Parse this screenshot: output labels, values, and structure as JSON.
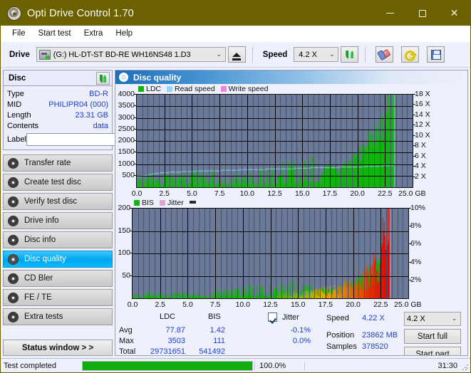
{
  "window": {
    "title": "Opti Drive Control 1.70",
    "icon": "disc-icon",
    "minimize": "–",
    "maximize": "□",
    "close": "✕"
  },
  "menu": {
    "items": [
      "File",
      "Start test",
      "Extra",
      "Help"
    ]
  },
  "toolbar": {
    "drive_label": "Drive",
    "drive_value": "(G:)  HL-DT-ST BD-RE  WH16NS48 1.D3",
    "eject_title": "eject-button",
    "speed_label": "Speed",
    "speed_value": "4.2 X",
    "refresh_title": "refresh-button",
    "erase_title": "erase-button",
    "key_title": "key-button",
    "save_title": "save-button",
    "arrow": "⌄"
  },
  "sidebar": {
    "disc": {
      "title": "Disc",
      "refresh_icon": "refresh-icon",
      "rows": [
        {
          "key": "Type",
          "value": "BD-R"
        },
        {
          "key": "MID",
          "value": "PHILIPR04 (000)"
        },
        {
          "key": "Length",
          "value": "23.31 GB"
        },
        {
          "key": "Contents",
          "value": "data"
        }
      ],
      "label_key": "Label",
      "label_value": "",
      "label_placeholder": "",
      "label_icon": "disc-icon"
    },
    "nav": [
      {
        "label": "Transfer rate",
        "active": false
      },
      {
        "label": "Create test disc",
        "active": false
      },
      {
        "label": "Verify test disc",
        "active": false
      },
      {
        "label": "Drive info",
        "active": false
      },
      {
        "label": "Disc info",
        "active": false
      },
      {
        "label": "Disc quality",
        "active": true
      },
      {
        "label": "CD Bler",
        "active": false
      },
      {
        "label": "FE / TE",
        "active": false
      },
      {
        "label": "Extra tests",
        "active": false
      }
    ],
    "status_window_button": "Status window > >"
  },
  "content": {
    "header_title": "Disc quality",
    "header_icon": "disc-quality-icon"
  },
  "stats": {
    "col_ldc": "LDC",
    "col_bis": "BIS",
    "jitter_label": "Jitter",
    "jitter_checked": true,
    "rows": [
      {
        "key": "Avg",
        "ldc": "77.87",
        "bis": "1.42",
        "jitter": "-0.1%"
      },
      {
        "key": "Max",
        "ldc": "3503",
        "bis": "111",
        "jitter": "0.0%"
      },
      {
        "key": "Total",
        "ldc": "29731651",
        "bis": "541492",
        "jitter": ""
      }
    ],
    "speed_key": "Speed",
    "speed_value": "4.22 X",
    "speed_select": "4.2 X",
    "position_key": "Position",
    "position_value": "23862 MB",
    "samples_key": "Samples",
    "samples_value": "378520",
    "start_full_button": "Start full",
    "start_part_button": "Start part"
  },
  "statusbar": {
    "text": "Test completed",
    "percent_label": "100.0%",
    "percent_value": 100,
    "time": "31:30"
  },
  "colors": {
    "ldc_green": "#11b40c",
    "read_speed_blue": "#8fd8f5",
    "write_speed_pink": "#f57fe0",
    "bis_green": "#11b40c",
    "jitter_pink": "#d9a8d9",
    "plot_bg": "#6b7a99",
    "title_bar": "#6b6100",
    "accent_active": "#00a6ef",
    "progress_green": "#12ac12",
    "value_blue": "#1a3fd0"
  },
  "chart_data": [
    {
      "type": "area",
      "name": "ldc-chart",
      "title": "",
      "xlabel": "GB",
      "ylabel": "",
      "xlim": [
        0,
        25
      ],
      "ylim": [
        0,
        4000
      ],
      "y2lim": [
        0,
        18
      ],
      "y2label": "X",
      "xticks": [
        0.0,
        2.5,
        5.0,
        7.5,
        10.0,
        12.5,
        15.0,
        17.5,
        20.0,
        22.5,
        25.0
      ],
      "xticklabels": [
        "0.0",
        "2.5",
        "5.0",
        "7.5",
        "10.0",
        "12.5",
        "15.0",
        "17.5",
        "20.0",
        "22.5",
        "25.0 GB"
      ],
      "yticks": [
        500,
        1000,
        1500,
        2000,
        2500,
        3000,
        3500,
        4000
      ],
      "yticklabels": [
        "500",
        "1000",
        "1500",
        "2000",
        "2500",
        "3000",
        "3500",
        "4000"
      ],
      "y2ticks": [
        2,
        4,
        6,
        8,
        10,
        12,
        14,
        16,
        18
      ],
      "y2ticklabels": [
        "2 X",
        "4 X",
        "6 X",
        "8 X",
        "10 X",
        "12 X",
        "14 X",
        "16 X",
        "18 X"
      ],
      "grid": true,
      "legend": [
        "LDC",
        "Read speed",
        "Write speed"
      ],
      "legend_colors": [
        "#11b40c",
        "#8fd8f5",
        "#f57fe0"
      ],
      "legend_position": "top-left",
      "series": [
        {
          "name": "LDC",
          "type": "area",
          "color": "#11b40c",
          "axis": "left",
          "x": [
            0.0,
            0.5,
            1.0,
            1.5,
            2.0,
            2.5,
            3.0,
            3.5,
            4.0,
            4.5,
            5.0,
            5.5,
            6.0,
            6.5,
            7.0,
            7.5,
            8.0,
            8.5,
            9.0,
            9.5,
            10.0,
            10.5,
            11.0,
            11.5,
            12.0,
            12.5,
            13.0,
            13.5,
            14.0,
            14.5,
            15.0,
            15.5,
            16.0,
            16.5,
            17.0,
            17.5,
            18.0,
            18.5,
            19.0,
            19.5,
            20.0,
            20.5,
            21.0,
            21.5,
            22.0,
            22.5,
            23.0,
            23.3,
            23.5
          ],
          "values": [
            120,
            140,
            150,
            160,
            150,
            170,
            160,
            175,
            165,
            180,
            170,
            185,
            175,
            190,
            180,
            195,
            185,
            200,
            190,
            205,
            200,
            215,
            210,
            225,
            230,
            240,
            250,
            270,
            290,
            300,
            320,
            340,
            380,
            420,
            470,
            560,
            540,
            600,
            680,
            780,
            900,
            1050,
            1250,
            1500,
            1800,
            2300,
            3200,
            3503,
            0
          ]
        },
        {
          "name": "Read speed",
          "type": "line",
          "color": "#8fd8f5",
          "axis": "right",
          "x": [
            0.0,
            0.8,
            1.6,
            2.5,
            3.5,
            4.5,
            5.5,
            6.5,
            7.5,
            8.5,
            9.5,
            10.5,
            11.5,
            12.5,
            13.5,
            14.5,
            15.5,
            16.5,
            17.5,
            18.5,
            19.5,
            20.5,
            21.5,
            22.5,
            23.3
          ],
          "values": [
            2.1,
            2.3,
            2.7,
            2.9,
            3.0,
            3.1,
            3.2,
            3.25,
            3.3,
            3.4,
            3.45,
            3.5,
            3.55,
            3.6,
            3.65,
            3.7,
            3.8,
            3.85,
            3.9,
            3.95,
            4.0,
            4.05,
            4.15,
            4.2,
            4.22
          ]
        },
        {
          "name": "Write speed",
          "type": "line",
          "color": "#f57fe0",
          "axis": "right",
          "x": [],
          "values": []
        }
      ],
      "annotations": [
        {
          "type": "vline",
          "x": 23.35,
          "color": "#62d6f7",
          "label": "current-position-marker"
        }
      ]
    },
    {
      "type": "area",
      "name": "bis-chart",
      "title": "",
      "xlabel": "GB",
      "ylabel": "",
      "xlim": [
        0,
        25
      ],
      "ylim": [
        0,
        200
      ],
      "y2lim": [
        0,
        10
      ],
      "y2label": "%",
      "xticks": [
        0.0,
        2.5,
        5.0,
        7.5,
        10.0,
        12.5,
        15.0,
        17.5,
        20.0,
        22.5,
        25.0
      ],
      "xticklabels": [
        "0.0",
        "2.5",
        "5.0",
        "7.5",
        "10.0",
        "12.5",
        "15.0",
        "17.5",
        "20.0",
        "22.5",
        "25.0 GB"
      ],
      "yticks": [
        50,
        100,
        150,
        200
      ],
      "yticklabels": [
        "50",
        "100",
        "150",
        "200"
      ],
      "y2ticks": [
        2,
        4,
        6,
        8,
        10
      ],
      "y2ticklabels": [
        "2%",
        "4%",
        "6%",
        "8%",
        "10%"
      ],
      "grid": true,
      "legend": [
        "BIS",
        "Jitter"
      ],
      "legend_colors": [
        "#11b40c",
        "#d9a8d9"
      ],
      "legend_position": "top-left",
      "series": [
        {
          "name": "BIS",
          "type": "area",
          "color": "#11b40c",
          "axis": "left",
          "x": [
            0.0,
            0.5,
            1.0,
            1.5,
            2.0,
            2.5,
            3.0,
            3.5,
            4.0,
            4.5,
            5.0,
            5.5,
            6.0,
            6.5,
            7.0,
            7.5,
            8.0,
            8.5,
            9.0,
            9.5,
            10.0,
            10.5,
            11.0,
            11.5,
            12.0,
            12.5,
            13.0,
            13.5,
            14.0,
            14.5,
            15.0,
            15.5,
            16.0,
            16.5,
            17.0,
            17.5,
            18.0,
            18.5,
            19.0,
            19.5,
            20.0,
            20.5,
            21.0,
            21.5,
            22.0,
            22.5,
            23.0,
            23.3,
            23.5
          ],
          "values": [
            2,
            3,
            3,
            4,
            3,
            4,
            3,
            4,
            4,
            4,
            4,
            5,
            4,
            5,
            5,
            5,
            5,
            6,
            5,
            6,
            6,
            7,
            6,
            7,
            7,
            8,
            7,
            8,
            8,
            9,
            9,
            10,
            10,
            11,
            12,
            14,
            13,
            15,
            17,
            20,
            24,
            28,
            34,
            42,
            55,
            75,
            100,
            111,
            0
          ]
        },
        {
          "name": "Jitter",
          "type": "line",
          "color": "#d9a8d9",
          "axis": "right",
          "x": [
            0.0,
            5.0,
            10.0,
            15.0,
            20.0,
            23.3
          ],
          "values": [
            0.0,
            0.0,
            0.0,
            0.0,
            0.0,
            0.0
          ]
        }
      ],
      "annotations": [
        {
          "type": "vline",
          "x": 23.35,
          "color": "#62d6f7",
          "label": "current-position-marker"
        }
      ]
    }
  ]
}
